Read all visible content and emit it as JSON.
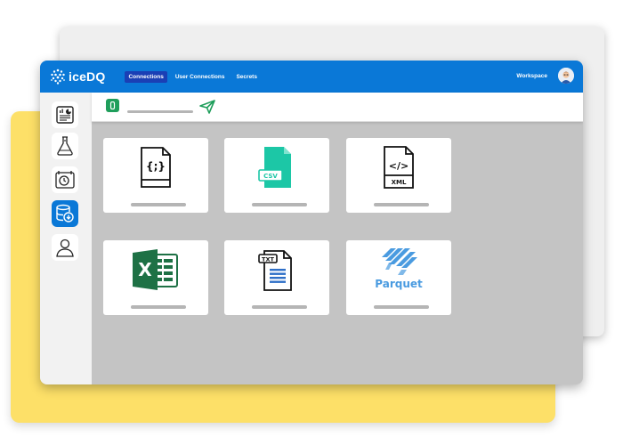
{
  "app": {
    "name": "iceDQ"
  },
  "nav": {
    "tabs": [
      {
        "label": "Connections",
        "active": true
      },
      {
        "label": "User Connections",
        "active": false
      },
      {
        "label": "Secrets",
        "active": false
      }
    ],
    "workspace_label": "Workspace"
  },
  "sidebar": {
    "items": [
      {
        "icon": "dashboard-icon",
        "active": false
      },
      {
        "icon": "flask-icon",
        "active": false
      },
      {
        "icon": "scheduler-icon",
        "active": false
      },
      {
        "icon": "database-connection-icon",
        "active": true
      },
      {
        "icon": "user-icon",
        "active": false
      }
    ]
  },
  "tiles": [
    {
      "icon": "json-file-icon",
      "glyph": "{;}"
    },
    {
      "icon": "csv-file-icon",
      "badge": "CSV"
    },
    {
      "icon": "xml-file-icon",
      "glyph": "</>",
      "badge": "XML"
    },
    {
      "icon": "excel-file-icon",
      "badge": "X"
    },
    {
      "icon": "txt-file-icon",
      "badge": "TXT"
    },
    {
      "icon": "parquet-icon",
      "badge": "Parquet"
    }
  ],
  "colors": {
    "brand_blue": "#0A78D7",
    "active_tab": "#1A3FB5",
    "csv_teal": "#1CC7A6",
    "excel_green": "#1E7145",
    "parquet_blue": "#4A9BE0",
    "yellow_card": "#FDE068"
  }
}
